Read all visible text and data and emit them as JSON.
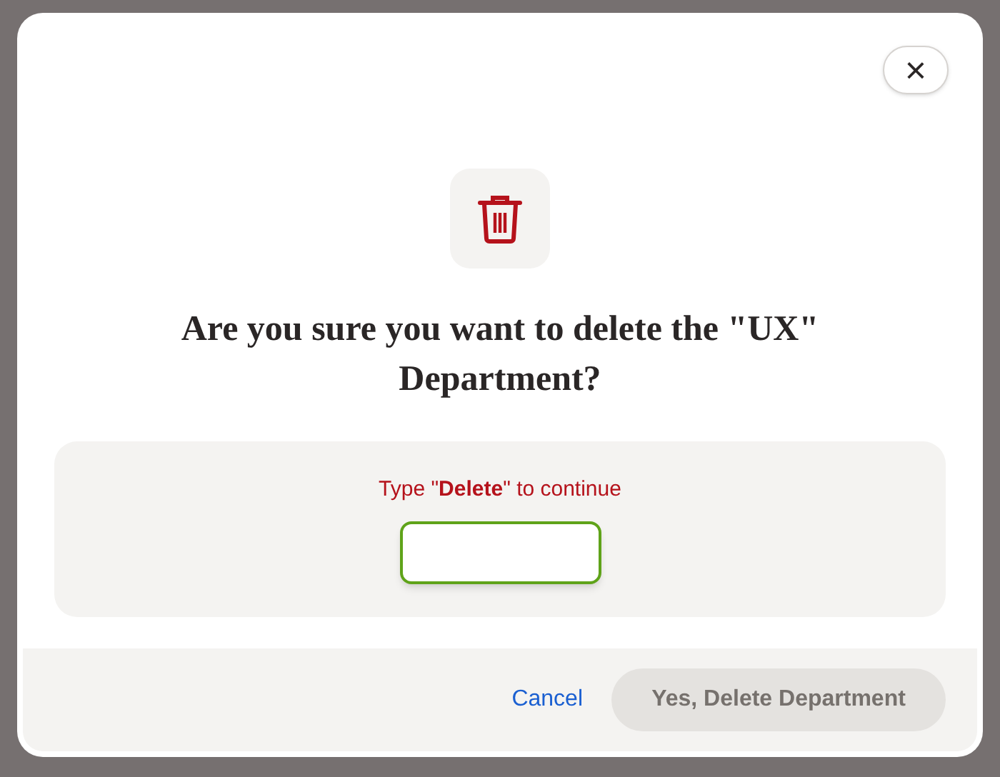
{
  "dialog": {
    "close_label": "×",
    "title": "Are you sure you want to delete the \"UX\" Department?",
    "prompt": "Type \"**Delete**\" to continue",
    "input": {
      "focused": true
    },
    "cancel_label": "Cancel",
    "confirm": {
      "label": "Yes, Delete Department",
      "disabled": true
    }
  }
}
